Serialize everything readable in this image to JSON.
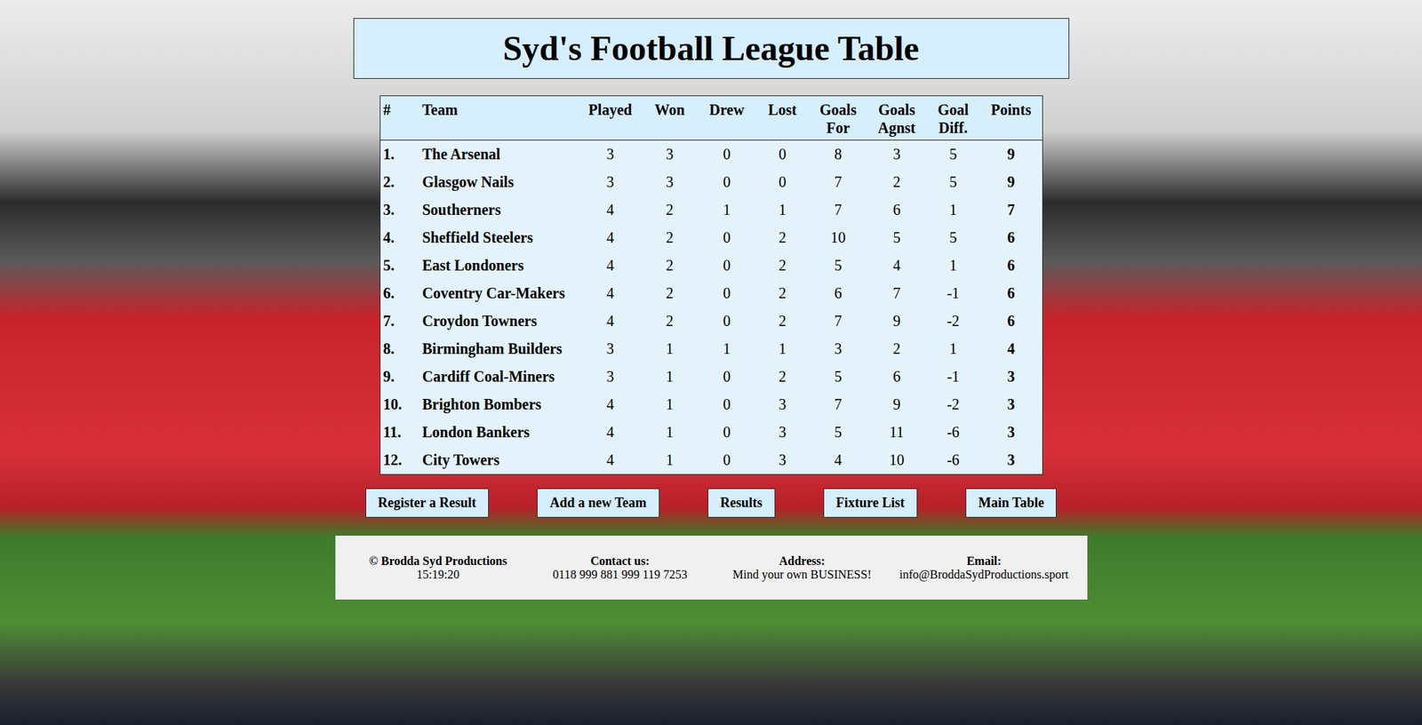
{
  "page": {
    "title": "Syd's Football League Table"
  },
  "table": {
    "columns": [
      "#",
      "Team",
      "Played",
      "Won",
      "Drew",
      "Lost",
      "Goals For",
      "Goals Agnst",
      "Goal Diff.",
      "Points"
    ],
    "rows": [
      [
        "1.",
        "The Arsenal",
        "3",
        "3",
        "0",
        "0",
        "8",
        "3",
        "5",
        "9"
      ],
      [
        "2.",
        "Glasgow Nails",
        "3",
        "3",
        "0",
        "0",
        "7",
        "2",
        "5",
        "9"
      ],
      [
        "3.",
        "Southerners",
        "4",
        "2",
        "1",
        "1",
        "7",
        "6",
        "1",
        "7"
      ],
      [
        "4.",
        "Sheffield Steelers",
        "4",
        "2",
        "0",
        "2",
        "10",
        "5",
        "5",
        "6"
      ],
      [
        "5.",
        "East Londoners",
        "4",
        "2",
        "0",
        "2",
        "5",
        "4",
        "1",
        "6"
      ],
      [
        "6.",
        "Coventry Car-Makers",
        "4",
        "2",
        "0",
        "2",
        "6",
        "7",
        "-1",
        "6"
      ],
      [
        "7.",
        "Croydon Towners",
        "4",
        "2",
        "0",
        "2",
        "7",
        "9",
        "-2",
        "6"
      ],
      [
        "8.",
        "Birmingham Builders",
        "3",
        "1",
        "1",
        "1",
        "3",
        "2",
        "1",
        "4"
      ],
      [
        "9.",
        "Cardiff Coal-Miners",
        "3",
        "1",
        "0",
        "2",
        "5",
        "6",
        "-1",
        "3"
      ],
      [
        "10.",
        "Brighton Bombers",
        "4",
        "1",
        "0",
        "3",
        "7",
        "9",
        "-2",
        "3"
      ],
      [
        "11.",
        "London Bankers",
        "4",
        "1",
        "0",
        "3",
        "5",
        "11",
        "-6",
        "3"
      ],
      [
        "12.",
        "City Towers",
        "4",
        "1",
        "0",
        "3",
        "4",
        "10",
        "-6",
        "3"
      ]
    ]
  },
  "nav": [
    "Register a Result",
    "Add a new Team",
    "Results",
    "Fixture List",
    "Main Table"
  ],
  "footer": [
    {
      "label": "© Brodda Syd Productions",
      "value": "15:19:20"
    },
    {
      "label": "Contact us:",
      "value": "0118 999 881 999 119 7253"
    },
    {
      "label": "Address:",
      "value": "Mind your own BUSINESS!"
    },
    {
      "label": "Email:",
      "value": "info@BroddaSydProductions.sport"
    }
  ]
}
